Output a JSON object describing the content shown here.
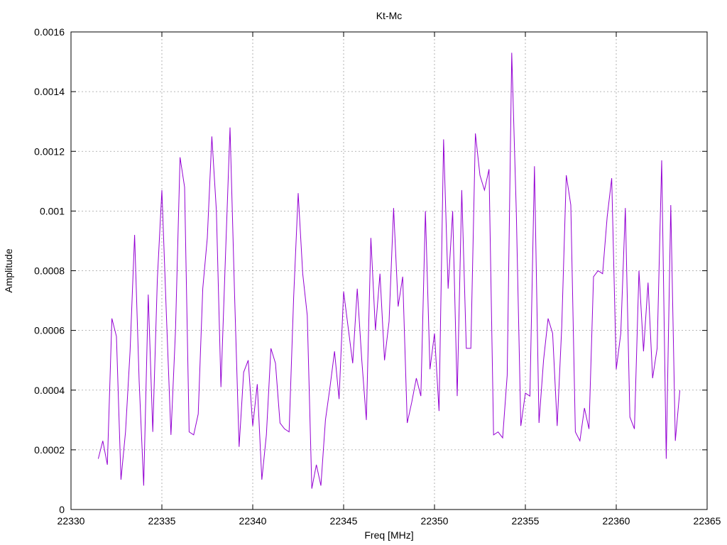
{
  "chart_data": {
    "type": "line",
    "title": "Kt-Mc",
    "xlabel": "Freq [MHz]",
    "ylabel": "Amplitude",
    "xlim": [
      22330,
      22365
    ],
    "ylim": [
      0,
      0.0016
    ],
    "x_ticks": [
      22330,
      22335,
      22340,
      22345,
      22350,
      22355,
      22360,
      22365
    ],
    "y_ticks": [
      0,
      0.0002,
      0.0004,
      0.0006,
      0.0008,
      0.001,
      0.0012,
      0.0014,
      0.0016
    ],
    "x_tick_labels": [
      "22330",
      "22335",
      "22340",
      "22345",
      "22350",
      "22355",
      "22360",
      "22365"
    ],
    "y_tick_labels": [
      "0",
      "0.0002",
      "0.0004",
      "0.0006",
      "0.0008",
      "0.001",
      "0.0012",
      "0.0014",
      "0.0016"
    ],
    "grid": true,
    "color": "#9400d3",
    "series": [
      {
        "x": [
          22331.5,
          22331.75,
          22332.0,
          22332.25,
          22332.5,
          22332.75,
          22333.0,
          22333.25,
          22333.5,
          22333.75,
          22334.0,
          22334.25,
          22334.5,
          22334.75,
          22335.0,
          22335.25,
          22335.5,
          22335.75,
          22336.0,
          22336.25,
          22336.5,
          22336.75,
          22337.0,
          22337.25,
          22337.5,
          22337.75,
          22338.0,
          22338.25,
          22338.5,
          22338.75,
          22339.0,
          22339.25,
          22339.5,
          22339.75,
          22340.0,
          22340.25,
          22340.5,
          22340.75,
          22341.0,
          22341.25,
          22341.5,
          22341.75,
          22342.0,
          22342.25,
          22342.5,
          22342.75,
          22343.0,
          22343.25,
          22343.5,
          22343.75,
          22344.0,
          22344.25,
          22344.5,
          22344.75,
          22345.0,
          22345.25,
          22345.5,
          22345.75,
          22346.0,
          22346.25,
          22346.5,
          22346.75,
          22347.0,
          22347.25,
          22347.5,
          22347.75,
          22348.0,
          22348.25,
          22348.5,
          22348.75,
          22349.0,
          22349.25,
          22349.5,
          22349.75,
          22350.0,
          22350.25,
          22350.5,
          22350.75,
          22351.0,
          22351.25,
          22351.5,
          22351.75,
          22352.0,
          22352.25,
          22352.5,
          22352.75,
          22353.0,
          22353.25,
          22353.5,
          22353.75,
          22354.0,
          22354.25,
          22354.5,
          22354.75,
          22355.0,
          22355.25,
          22355.5,
          22355.75,
          22356.0,
          22356.25,
          22356.5,
          22356.75,
          22357.0,
          22357.25,
          22357.5,
          22357.75,
          22358.0,
          22358.25,
          22358.5,
          22358.75,
          22359.0,
          22359.25,
          22359.5,
          22359.75,
          22360.0,
          22360.25,
          22360.5,
          22360.75,
          22361.0,
          22361.25,
          22361.5,
          22361.75,
          22362.0,
          22362.25,
          22362.5,
          22362.75,
          22363.0,
          22363.25,
          22363.5
        ],
        "y": [
          0.00017,
          0.00023,
          0.00015,
          0.00064,
          0.00058,
          0.0001,
          0.00026,
          0.00053,
          0.00092,
          0.00043,
          8e-05,
          0.00072,
          0.00026,
          0.00077,
          0.00107,
          0.00065,
          0.00025,
          0.0006,
          0.00118,
          0.00108,
          0.00026,
          0.00025,
          0.00032,
          0.00074,
          0.00091,
          0.00125,
          0.001,
          0.00041,
          0.00085,
          0.00128,
          0.00072,
          0.00021,
          0.00046,
          0.0005,
          0.00028,
          0.00042,
          0.0001,
          0.00025,
          0.00054,
          0.00049,
          0.00029,
          0.00027,
          0.00026,
          0.00071,
          0.00106,
          0.00079,
          0.00065,
          7e-05,
          0.00015,
          8e-05,
          0.0003,
          0.00041,
          0.00053,
          0.00037,
          0.00073,
          0.00061,
          0.00049,
          0.00074,
          0.0005,
          0.0003,
          0.00091,
          0.0006,
          0.00079,
          0.0005,
          0.00063,
          0.00101,
          0.00068,
          0.00078,
          0.00029,
          0.00036,
          0.00044,
          0.00038,
          0.001,
          0.00047,
          0.00059,
          0.00033,
          0.00124,
          0.00074,
          0.001,
          0.00038,
          0.00107,
          0.00054,
          0.00054,
          0.00126,
          0.00112,
          0.00107,
          0.00114,
          0.00025,
          0.00026,
          0.00024,
          0.00045,
          0.00153,
          0.001,
          0.00028,
          0.00039,
          0.00038,
          0.00115,
          0.00029,
          0.0005,
          0.00064,
          0.00059,
          0.00028,
          0.00061,
          0.00112,
          0.00102,
          0.00026,
          0.00023,
          0.00034,
          0.00027,
          0.00078,
          0.0008,
          0.00079,
          0.00098,
          0.00111,
          0.00047,
          0.00059,
          0.00101,
          0.00031,
          0.00027,
          0.0008,
          0.00053,
          0.00076,
          0.00044,
          0.00054,
          0.00117,
          0.00017,
          0.00102,
          0.00023,
          0.0004
        ]
      }
    ]
  }
}
